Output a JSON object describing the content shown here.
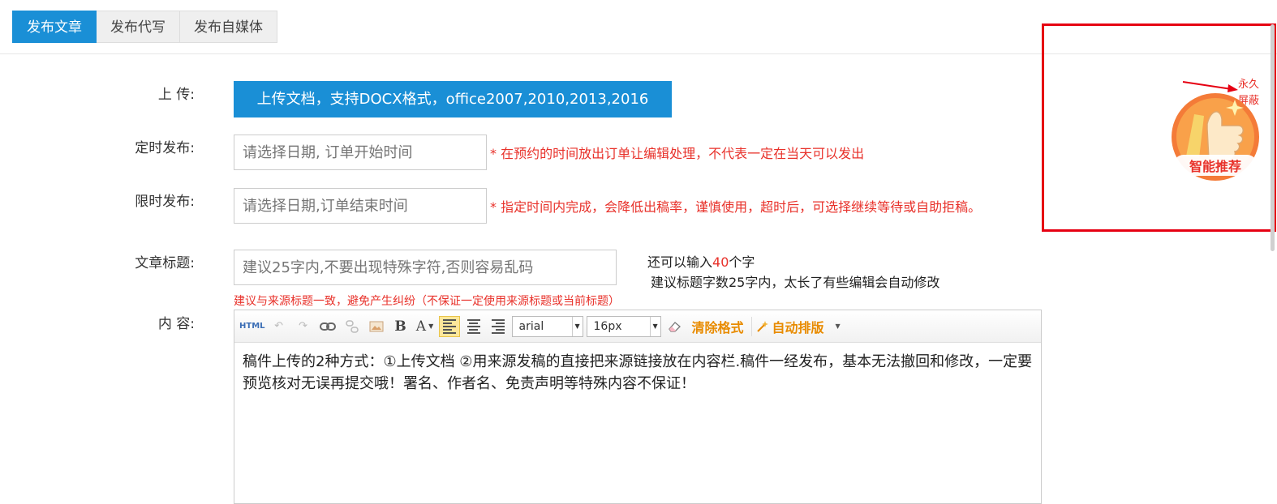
{
  "tabs": [
    {
      "label": "发布文章",
      "active": true
    },
    {
      "label": "发布代写",
      "active": false
    },
    {
      "label": "发布自媒体",
      "active": false
    }
  ],
  "form": {
    "upload": {
      "label": "上 传:",
      "button": "上传文档，支持DOCX格式，office2007,2010,2013,2016"
    },
    "schedule": {
      "label": "定时发布:",
      "placeholder": "请选择日期, 订单开始时间",
      "note": "* 在预约的时间放出订单让编辑处理，不代表一定在当天可以发出"
    },
    "deadline": {
      "label": "限时发布:",
      "placeholder": "请选择日期,订单结束时间",
      "note": "* 指定时间内完成，会降低出稿率，谨慎使用，超时后，可选择继续等待或自助拒稿。"
    },
    "title": {
      "label": "文章标题:",
      "placeholder": "建议25字内,不要出现特殊字符,否则容易乱码",
      "remaining_prefix": "还可以输入",
      "remaining_count": "40",
      "remaining_suffix": "个字",
      "hint": "建议标题字数25字内，太长了有些编辑会自动修改",
      "source_note": "建议与来源标题一致，避免产生纠纷（不保证一定使用来源标题或当前标题）"
    },
    "content": {
      "label": "内 容:",
      "toolbar": {
        "html": "HTML",
        "bold": "B",
        "font_color": "A",
        "font_family": "arial",
        "font_size": "16px",
        "clear_format": "清除格式",
        "auto_layout": "自动排版"
      },
      "body": "稿件上传的2种方式：①上传文档 ②用来源发稿的直接把来源链接放在内容栏.稿件一经发布，基本无法撤回和修改，一定要预览核对无误再提交哦！署名、作者名、免责声明等特殊内容不保证！"
    }
  },
  "widget": {
    "close_line1": "永久",
    "close_line2": "屏蔽",
    "badge_label": "智能推荐"
  },
  "colors": {
    "accent": "#1a8fd6",
    "warning": "#e8312a",
    "highlight": "#e60012"
  }
}
